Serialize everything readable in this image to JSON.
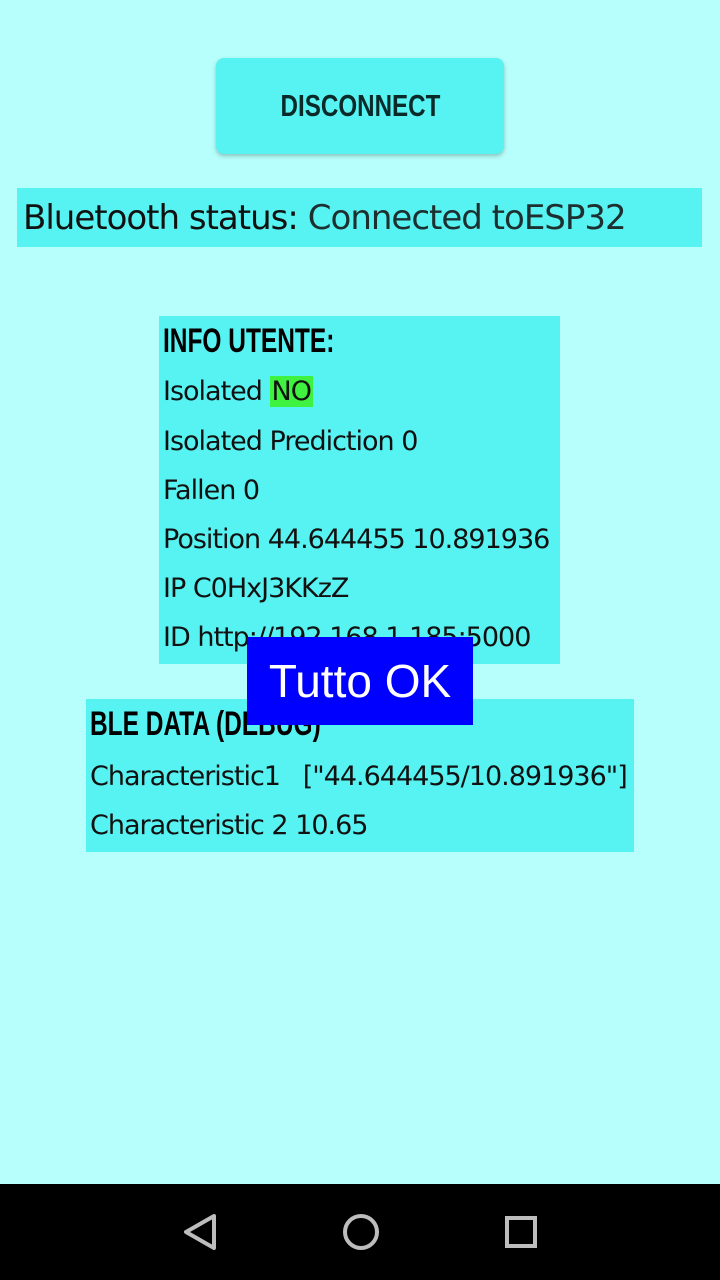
{
  "disconnect_label": "DISCONNECT",
  "bluetooth": {
    "label": "Bluetooth status:",
    "value": "Connected toESP32"
  },
  "info": {
    "heading": "INFO UTENTE:",
    "isolated_label": "Isolated",
    "isolated_value": "NO",
    "isolated_prediction": "Isolated Prediction 0",
    "fallen": "Fallen 0",
    "position": "Position 44.644455 10.891936",
    "ip": "IP C0HxJ3KKzZ",
    "id": "ID http://192.168.1.185:5000"
  },
  "ble": {
    "heading": "BLE DATA (DEBUG)",
    "characteristic1": "Characteristic1   [\"44.644455/10.891936\"]",
    "characteristic2": "Characteristic 2 10.65"
  },
  "toast": "Tutto OK",
  "navbar": {
    "back_icon": "back-triangle-icon",
    "home_icon": "home-circle-icon",
    "recents_icon": "recents-square-icon"
  },
  "colors": {
    "background": "#b6fffc",
    "panel": "#57f2f2",
    "toast": "#0000ff",
    "no_badge": "#3ff23f"
  }
}
